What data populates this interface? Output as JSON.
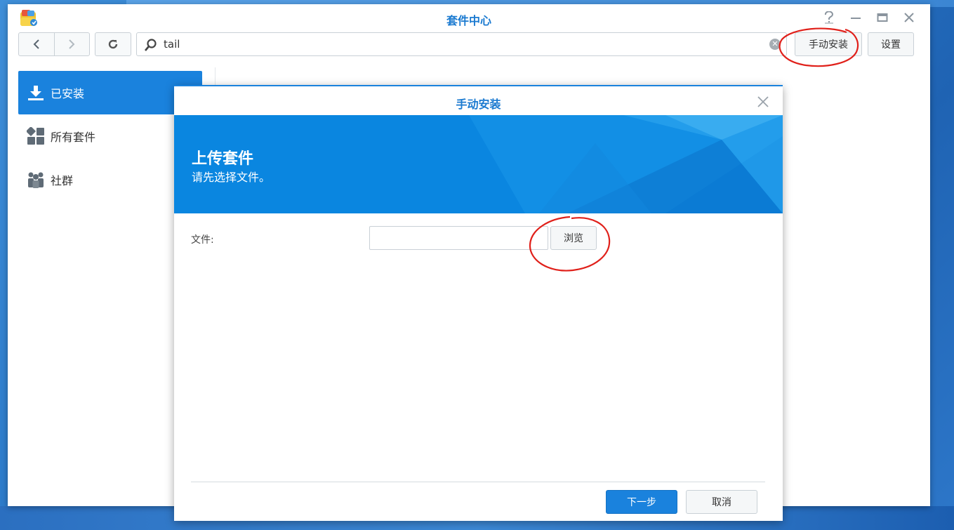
{
  "window": {
    "title": "套件中心",
    "controls": {
      "help": "help-icon",
      "minimize": "minimize-icon",
      "maximize": "maximize-icon",
      "close": "close-icon"
    }
  },
  "toolbar": {
    "search_value": "tail",
    "manual_install_label": "手动安装",
    "settings_label": "设置"
  },
  "sidebar": {
    "items": [
      {
        "label": "已安装",
        "icon": "download-icon",
        "active": true
      },
      {
        "label": "所有套件",
        "icon": "grid-icon",
        "active": false
      },
      {
        "label": "社群",
        "icon": "people-icon",
        "active": false
      }
    ]
  },
  "modal": {
    "title": "手动安装",
    "banner_title": "上传套件",
    "banner_subtitle": "请先选择文件。",
    "file_label": "文件:",
    "file_value": "",
    "browse_label": "浏览",
    "next_label": "下一步",
    "cancel_label": "取消"
  },
  "colors": {
    "accent": "#1a82dd",
    "annotation": "#e0201a"
  }
}
